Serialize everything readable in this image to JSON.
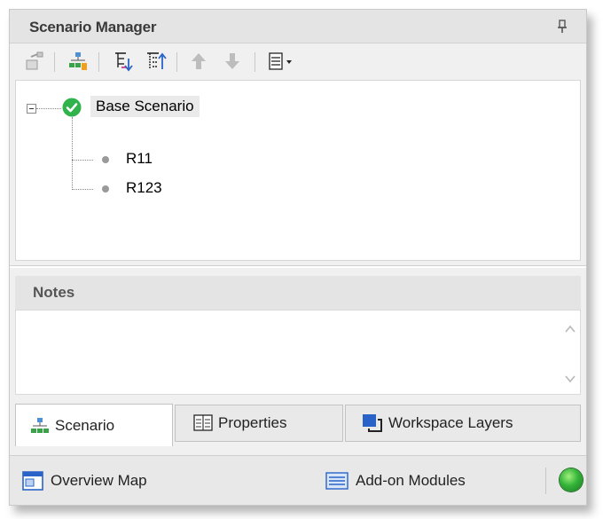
{
  "panel": {
    "title": "Scenario Manager"
  },
  "toolbar": {
    "buttons": [
      {
        "icon": "promote-scenario-icon"
      },
      {
        "icon": "create-child-scenario-icon"
      },
      {
        "icon": "expand-tree-icon"
      },
      {
        "icon": "collapse-tree-icon"
      },
      {
        "icon": "move-up-icon"
      },
      {
        "icon": "move-down-icon"
      },
      {
        "icon": "view-options-icon"
      }
    ]
  },
  "tree": {
    "root": {
      "label": "Base Scenario",
      "status": "current"
    },
    "children": [
      {
        "label": "R11"
      },
      {
        "label": "R123"
      }
    ]
  },
  "notes": {
    "title": "Notes",
    "text": ""
  },
  "tabs": [
    {
      "label": "Scenario",
      "icon": "scenario-tree-icon",
      "active": true
    },
    {
      "label": "Properties",
      "icon": "properties-icon",
      "active": false
    },
    {
      "label": "Workspace Layers",
      "icon": "workspace-layers-icon",
      "active": false
    }
  ],
  "statusbar": {
    "overview_map": "Overview Map",
    "addon_modules": "Add-on Modules",
    "indicator_color": "#35b43a"
  }
}
